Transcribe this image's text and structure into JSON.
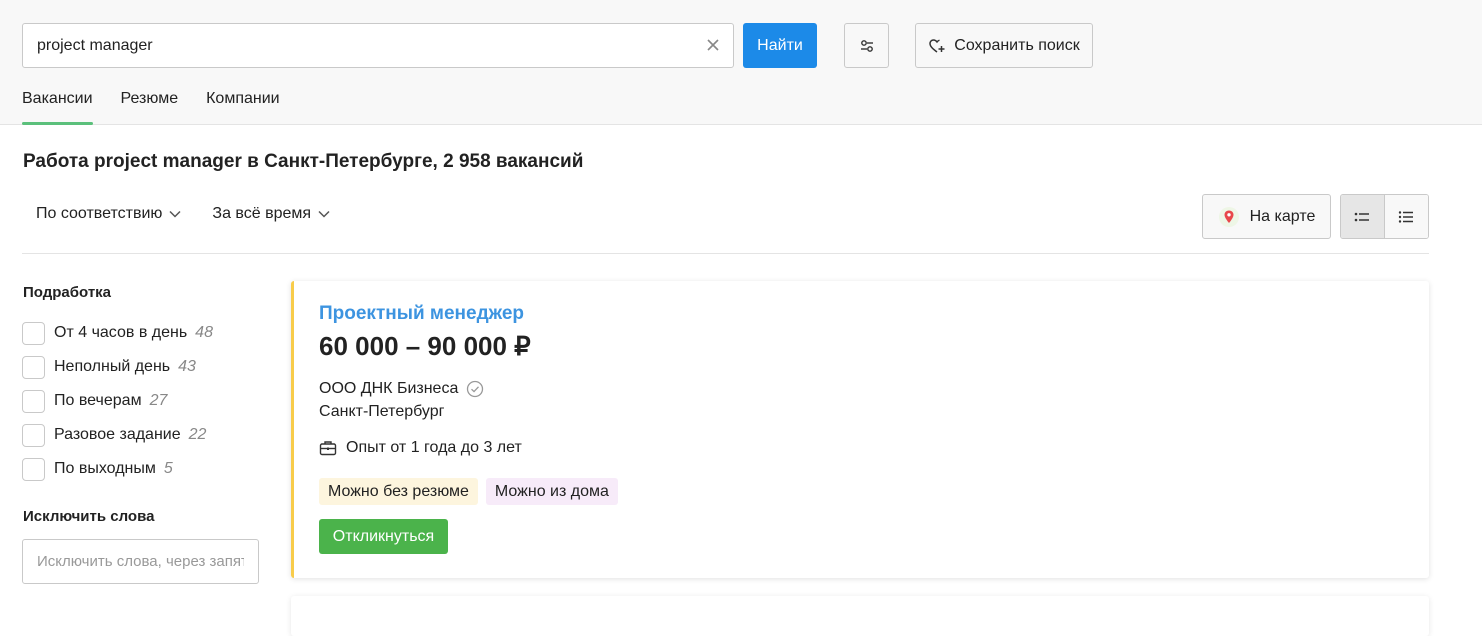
{
  "search": {
    "value": "project manager",
    "find_label": "Найти",
    "save_label": "Сохранить поиск"
  },
  "tabs": [
    {
      "label": "Вакансии",
      "active": true
    },
    {
      "label": "Резюме",
      "active": false
    },
    {
      "label": "Компании",
      "active": false
    }
  ],
  "page_title": "Работа project manager в Санкт-Петербурге, 2 958 вакансий",
  "sort": {
    "relevance": "По соответствию",
    "period": "За всё время"
  },
  "map_label": "На карте",
  "sidebar": {
    "part_time_title": "Подработка",
    "part_time_items": [
      {
        "label": "От 4 часов в день",
        "count": "48"
      },
      {
        "label": "Неполный день",
        "count": "43"
      },
      {
        "label": "По вечерам",
        "count": "27"
      },
      {
        "label": "Разовое задание",
        "count": "22"
      },
      {
        "label": "По выходным",
        "count": "5"
      }
    ],
    "exclude_title": "Исключить слова",
    "exclude_placeholder": "Исключить слова, через запятую"
  },
  "vacancy": {
    "title": "Проектный менеджер",
    "salary": "60 000 – 90 000 ₽",
    "company": "ООО ДНК Бизнеса",
    "city": "Санкт-Петербург",
    "experience": "Опыт от 1 года до 3 лет",
    "tags": [
      "Можно без резюме",
      "Можно из дома"
    ],
    "apply_label": "Откликнуться"
  },
  "colors": {
    "accent_blue": "#1c8ae8",
    "link_blue": "#3d94e0",
    "apply_green": "#4bb34b",
    "tab_underline": "#5bc07b",
    "card_border": "#f8cc4a"
  }
}
